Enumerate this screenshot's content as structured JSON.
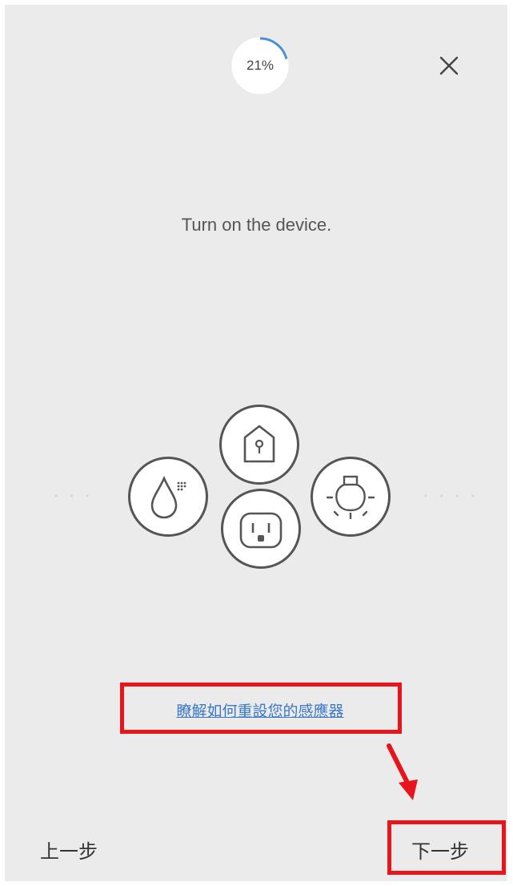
{
  "progress": {
    "percent_label": "21%",
    "fraction": 0.21,
    "accent_color": "#4a90d9"
  },
  "header": {
    "close_icon": "close-icon"
  },
  "main": {
    "instruction": "Turn on the device.",
    "device_icons": [
      "house-sensor-icon",
      "water-drop-icon",
      "light-bulb-icon",
      "power-outlet-icon"
    ],
    "reset_link": "瞭解如何重設您的感應器"
  },
  "footer": {
    "back_label": "上一步",
    "next_label": "下一步"
  },
  "annotation": {
    "highlight_color": "#e8141c"
  }
}
